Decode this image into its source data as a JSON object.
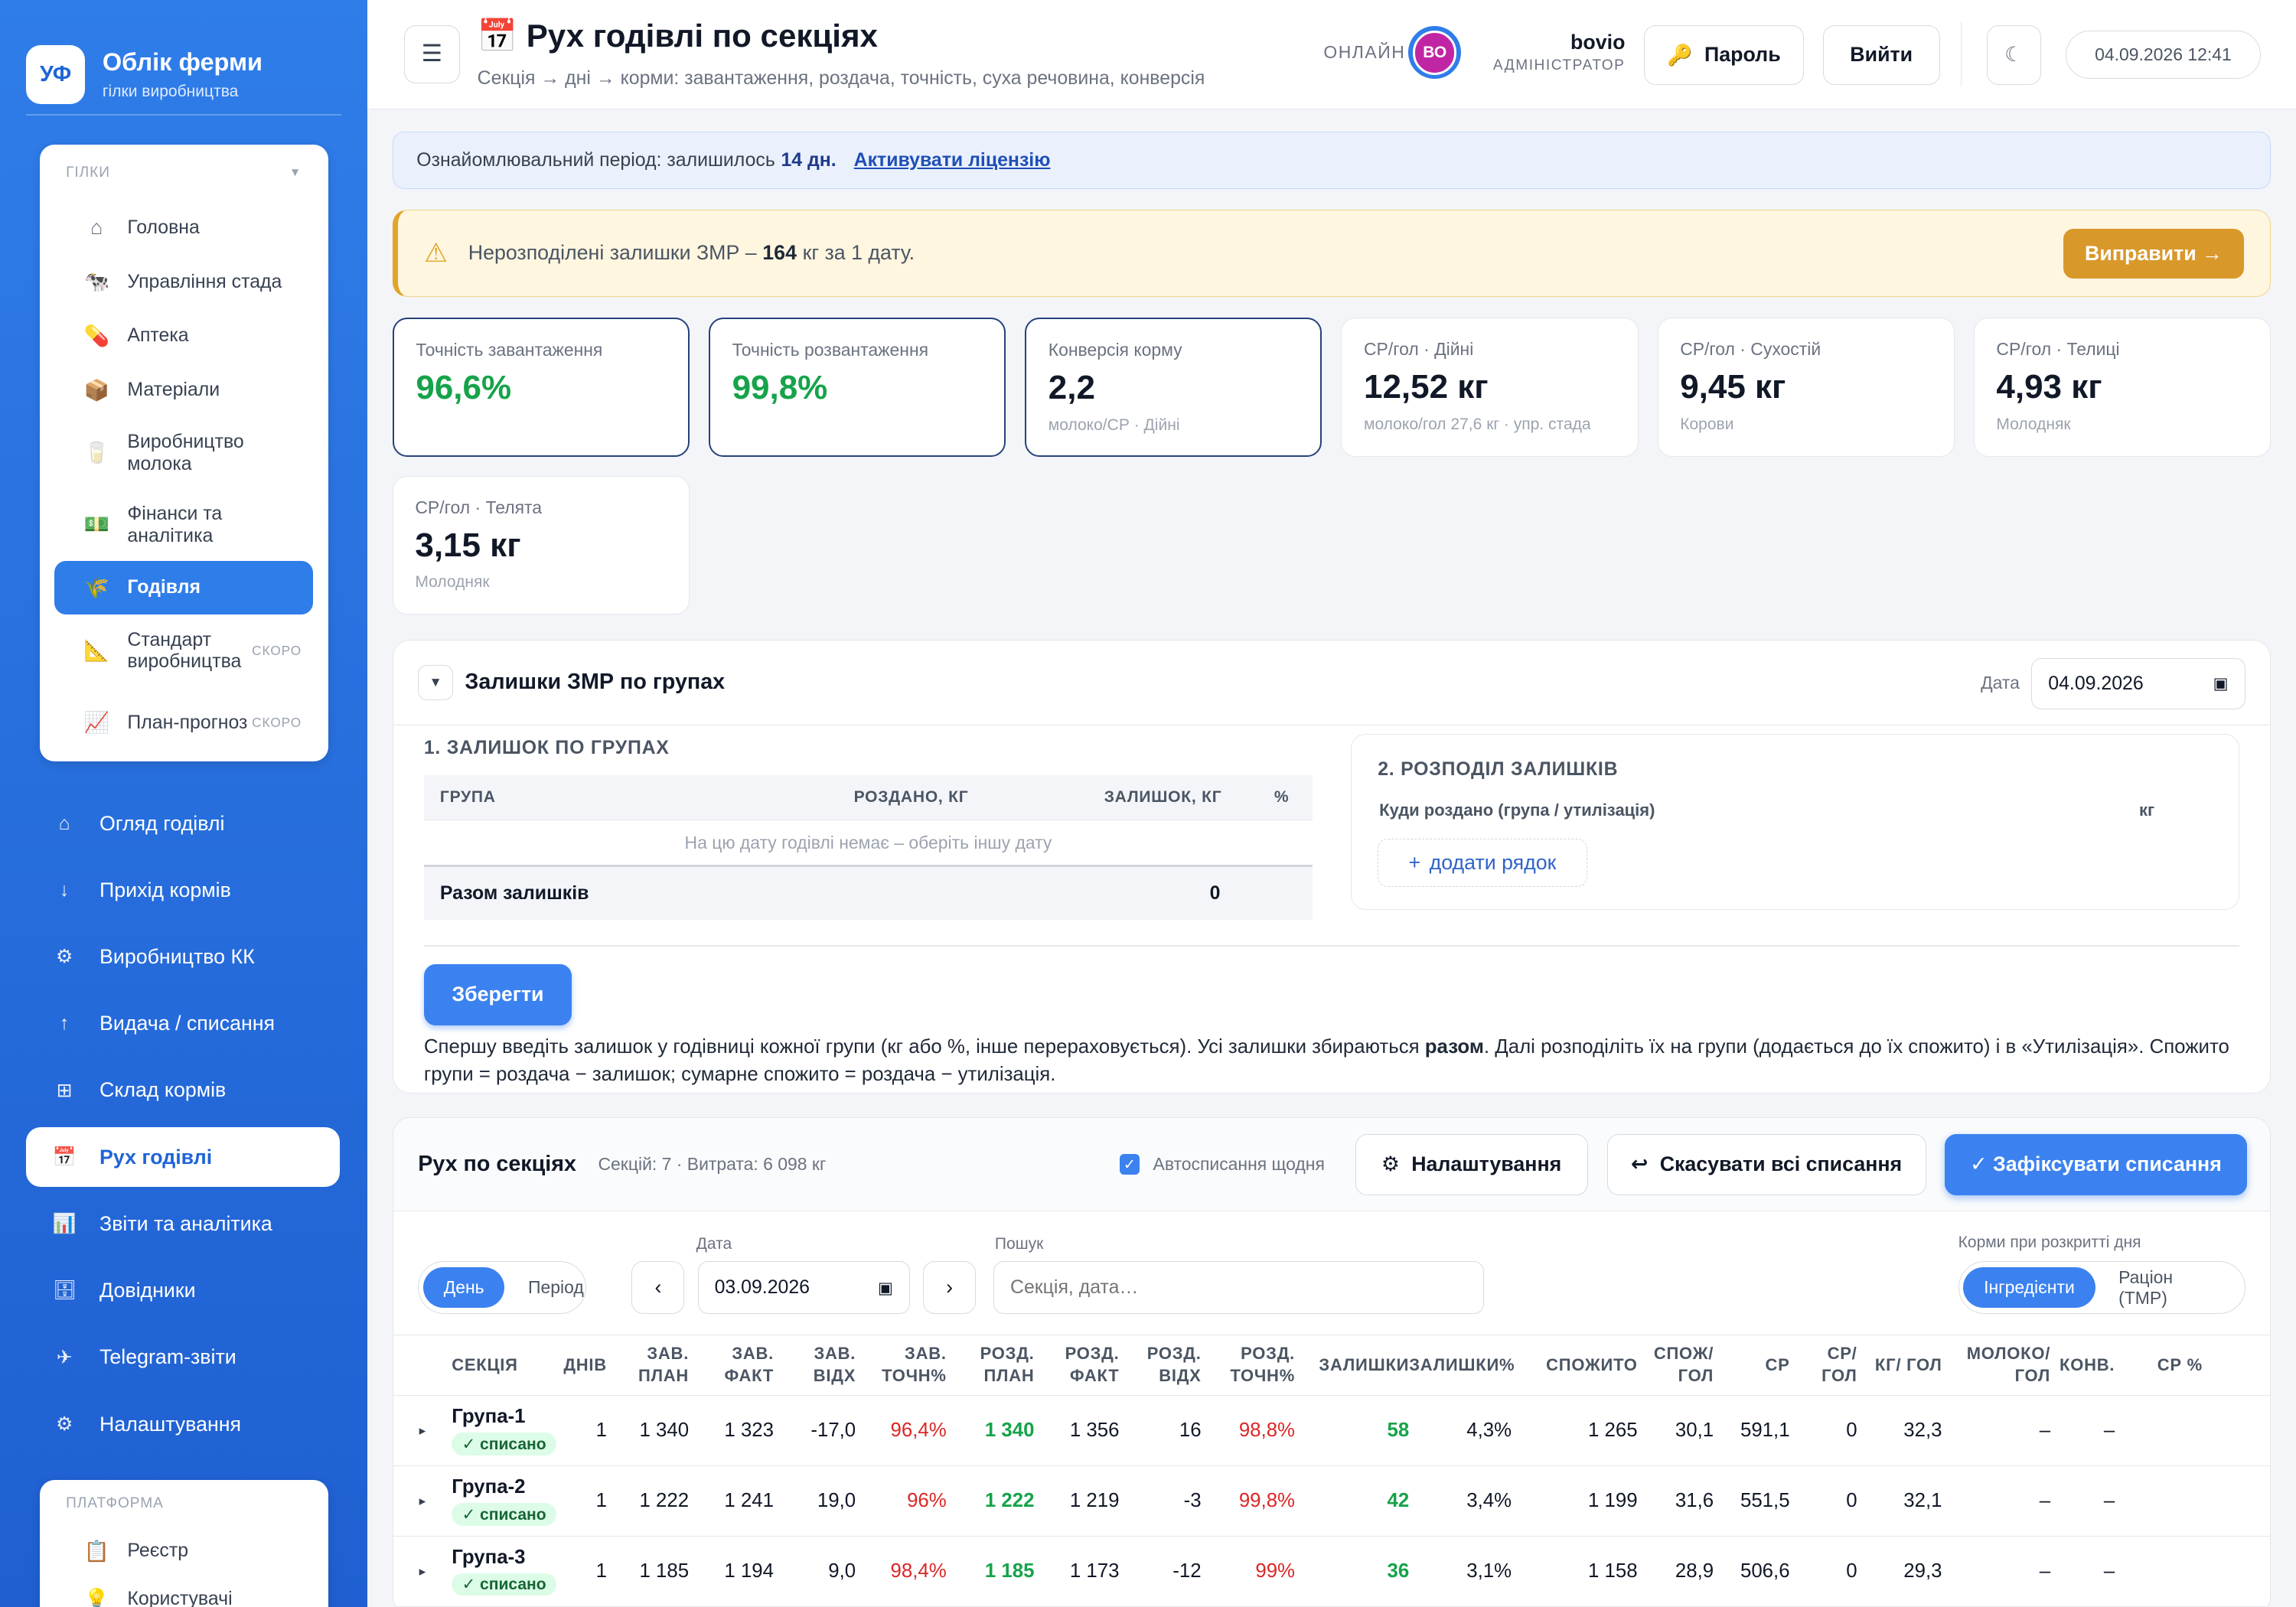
{
  "app": {
    "logo": "УФ",
    "title": "Облік ферми",
    "subtitle": "гілки виробництва"
  },
  "branches": {
    "heading": "ГІЛКИ",
    "items": [
      {
        "label": "Головна",
        "icon": "home-icon",
        "glyph": "⌂"
      },
      {
        "label": "Управління стада",
        "icon": "cow-icon",
        "glyph": "🐄"
      },
      {
        "label": "Аптека",
        "icon": "pill-icon",
        "glyph": "💊"
      },
      {
        "label": "Матеріали",
        "icon": "box-icon",
        "glyph": "📦"
      },
      {
        "label": "Виробництво молока",
        "icon": "milk-icon",
        "glyph": "🥛"
      },
      {
        "label": "Фінанси та аналітика",
        "icon": "money-icon",
        "glyph": "💵"
      },
      {
        "label": "Годівля",
        "icon": "feed-icon",
        "glyph": "🌾"
      },
      {
        "label": "Стандарт виробництва",
        "icon": "ruler-icon",
        "glyph": "📐",
        "soon": "СКОРО"
      },
      {
        "label": "План-прогноз",
        "icon": "chart-icon",
        "glyph": "📈",
        "soon": "СКОРО"
      }
    ]
  },
  "nav": [
    {
      "label": "Огляд годівлі",
      "glyph": "⌂",
      "icon": "home-icon"
    },
    {
      "label": "Прихід кормів",
      "glyph": "↓",
      "icon": "arrow-down-icon"
    },
    {
      "label": "Виробництво КК",
      "glyph": "⚙",
      "icon": "gear-icon"
    },
    {
      "label": "Видача / списання",
      "glyph": "↑",
      "icon": "arrow-up-icon"
    },
    {
      "label": "Склад кормів",
      "glyph": "⊞",
      "icon": "grid-icon"
    },
    {
      "label": "Рух годівлі",
      "glyph": "📅",
      "icon": "calendar-icon"
    },
    {
      "label": "Звіти та аналітика",
      "glyph": "📊",
      "icon": "bar-chart-icon"
    },
    {
      "label": "Довідники",
      "glyph": "🗄",
      "icon": "cabinet-icon"
    },
    {
      "label": "Telegram-звіти",
      "glyph": "✈",
      "icon": "telegram-icon"
    },
    {
      "label": "Налаштування",
      "glyph": "⚙",
      "icon": "settings-icon"
    }
  ],
  "platform": {
    "heading": "ПЛАТФОРМА",
    "items": [
      {
        "label": "Реєстр",
        "glyph": "📋"
      },
      {
        "label": "Користувачі",
        "glyph": "💡"
      }
    ]
  },
  "header": {
    "title_icon": "📅",
    "title": "Рух годівлі по секціях",
    "subtitle": "Секція → дні → корми: завантаження, роздача, точність, суха речовина, конверсія",
    "online": "ОНЛАЙН",
    "avatar": "ВО",
    "user_name": "bovio",
    "user_role": "АДМІНІСТРАТОР",
    "password_btn": "Пароль",
    "logout_btn": "Вийти",
    "theme_glyph": "☾",
    "datetime": "04.09.2026 12:41"
  },
  "trial": {
    "text": "Ознайомлювальний період: залишилось",
    "days": "14 дн.",
    "link": "Активувати ліцензію"
  },
  "warning": {
    "pre": "Нерозподілені залишки ЗМР –",
    "amount": "164",
    "post": "кг за 1 дату.",
    "btn": "Виправити →"
  },
  "kpis": [
    {
      "label": "Точність завантаження",
      "value": "96,6%",
      "green": true,
      "sub": ""
    },
    {
      "label": "Точність розвантаження",
      "value": "99,8%",
      "green": true,
      "sub": ""
    },
    {
      "label": "Конверсія корму",
      "value": "2,2",
      "green": false,
      "sub": "молоко/СР · Дійні"
    },
    {
      "label": "СР/гол · Дійні",
      "value": "12,52 кг",
      "green": false,
      "sub": "молоко/гол 27,6 кг · упр. стада"
    },
    {
      "label": "СР/гол · Сухостій",
      "value": "9,45 кг",
      "green": false,
      "sub": "Корови"
    },
    {
      "label": "СР/гол · Телиці",
      "value": "4,93 кг",
      "green": false,
      "sub": "Молодняк"
    },
    {
      "label": "СР/гол · Телята",
      "value": "3,15 кг",
      "green": false,
      "sub": "Молодняк"
    }
  ],
  "remains": {
    "title": "Залишки ЗМР по групах",
    "date_label": "Дата",
    "date": "04.09.2026",
    "s1": "1. ЗАЛИШОК ПО ГРУПАХ",
    "cols": [
      "ГРУПА",
      "РОЗДАНО, КГ",
      "ЗАЛИШОК, КГ",
      "%"
    ],
    "empty": "На цю дату годівлі немає – оберіть іншу дату",
    "total_label": "Разом залишків",
    "total_value": "0",
    "s2": "2. РОЗПОДІЛ ЗАЛИШКІВ",
    "dist_col1": "Куди роздано (група / утилізація)",
    "dist_col2": "кг",
    "add_row": "додати рядок",
    "save": "Зберегти",
    "note_1": "Спершу введіть залишок у годівниці кожної групи (кг або %, інше перераховується). Усі залишки збираються ",
    "note_b": "разом",
    "note_2": ". Далі розподіліть їх на групи (додається до їх спожито) і в «Утилізація». Спожито групи = роздача − залишок; сумарне спожито = роздача − утилізація."
  },
  "movement": {
    "title": "Рух по секціях",
    "meta": "Секцій: 7 · Витрата: 6 098 кг",
    "auto": "Автосписання щодня",
    "settings_btn": "Налаштування",
    "cancel_btn": "Скасувати всі списання",
    "fix_btn": "✓ Зафіксувати списання",
    "mode_day": "День",
    "mode_period": "Період",
    "date_label": "Дата",
    "date": "03.09.2026",
    "search_label": "Пошук",
    "search_ph": "Секція, дата…",
    "feeds_label": "Корми при розкритті дня",
    "feeds_ing": "Інгредієнти",
    "feeds_ration": "Раціон (ТМР)",
    "cols": [
      "СЕКЦІЯ",
      "ДНІВ",
      "ЗАВ. ПЛАН",
      "ЗАВ. ФАКТ",
      "ЗАВ. ВІДХ",
      "ЗАВ. ТОЧН%",
      "РОЗД. ПЛАН",
      "РОЗД. ФАКТ",
      "РОЗД. ВІДХ",
      "РОЗД. ТОЧН%",
      "ЗАЛИШКИ",
      "ЗАЛИШКИ%",
      "СПОЖИТО",
      "СПОЖ/ ГОЛ",
      "СР",
      "СР/ ГОЛ",
      "КГ/ ГОЛ",
      "МОЛОКО/ ГОЛ",
      "КОНВ.",
      "СР %"
    ],
    "rows": [
      {
        "name": "Група-1",
        "tag": "✓ списано",
        "v": [
          "1",
          "1 340",
          "1 323",
          "-17,0",
          "96,4%",
          "1 340",
          "1 356",
          "16",
          "98,8%",
          "58",
          "4,3%",
          "1 265",
          "30,1",
          "591,1",
          "0",
          "32,3",
          "–",
          "–",
          ""
        ]
      },
      {
        "name": "Група-2",
        "tag": "✓ списано",
        "v": [
          "1",
          "1 222",
          "1 241",
          "19,0",
          "96%",
          "1 222",
          "1 219",
          "-3",
          "99,8%",
          "42",
          "3,4%",
          "1 199",
          "31,6",
          "551,5",
          "0",
          "32,1",
          "–",
          "–",
          ""
        ]
      },
      {
        "name": "Група-3",
        "tag": "✓ списано",
        "v": [
          "1",
          "1 185",
          "1 194",
          "9,0",
          "98,4%",
          "1 185",
          "1 173",
          "-12",
          "99%",
          "36",
          "3,1%",
          "1 158",
          "28,9",
          "506,6",
          "0",
          "29,3",
          "–",
          "–",
          ""
        ]
      }
    ]
  }
}
